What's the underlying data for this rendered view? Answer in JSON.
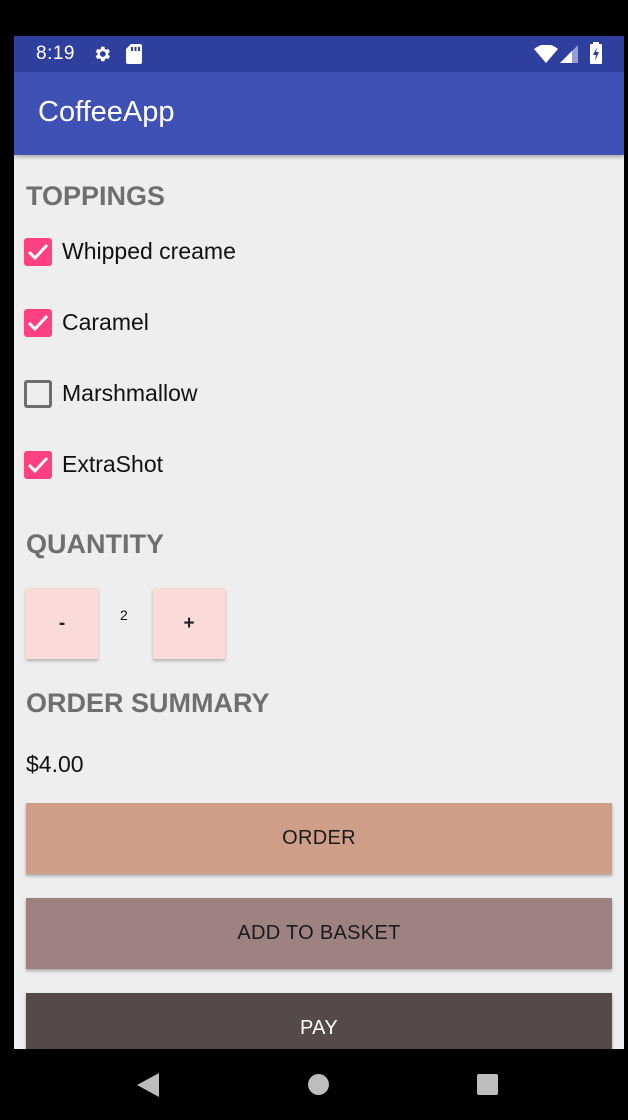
{
  "status_bar": {
    "time": "8:19",
    "icons": [
      "settings-icon",
      "sd-card-icon",
      "wifi-icon",
      "signal-icon",
      "battery-icon"
    ]
  },
  "app_bar": {
    "title": "CoffeeApp"
  },
  "toppings": {
    "heading": "TOPPINGS",
    "items": [
      {
        "label": "Whipped creame",
        "checked": true
      },
      {
        "label": "Caramel",
        "checked": true
      },
      {
        "label": "Marshmallow",
        "checked": false
      },
      {
        "label": "ExtraShot",
        "checked": true
      }
    ]
  },
  "quantity": {
    "heading": "QUANTITY",
    "decrement_label": "-",
    "value": "2",
    "increment_label": "+"
  },
  "order_summary": {
    "heading": "ORDER SUMMARY",
    "price": "$4.00"
  },
  "actions": {
    "order_label": "ORDER",
    "add_to_basket_label": "ADD TO BASKET",
    "pay_label": "PAY"
  },
  "colors": {
    "status_bar": "#2f3f9e",
    "app_bar": "#3f51b5",
    "checkbox_accent": "#ff4081",
    "quantity_button": "#fadbd8",
    "order_button": "#cf9e88",
    "add_to_basket_button": "#9e8282",
    "pay_button": "#554949"
  },
  "navigation": {
    "icons": [
      "back-icon",
      "home-icon",
      "recent-apps-icon"
    ]
  }
}
